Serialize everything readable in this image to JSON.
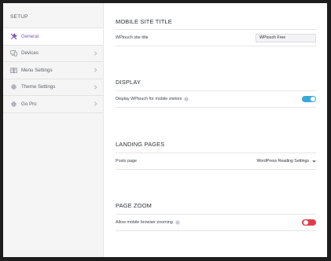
{
  "sidebar": {
    "header": "SETUP",
    "items": [
      {
        "label": "General",
        "icon": "wrench-icon",
        "active": true
      },
      {
        "label": "Devices",
        "icon": "devices-icon",
        "active": false
      },
      {
        "label": "Menu Settings",
        "icon": "menu-book-icon",
        "active": false
      },
      {
        "label": "Theme Settings",
        "icon": "gear-icon",
        "active": false
      },
      {
        "label": "Go Pro",
        "icon": "gear-icon",
        "active": false
      }
    ]
  },
  "sections": {
    "mobile_site_title": {
      "title": "MOBILE SITE TITLE",
      "field_label": "WPtouch site title",
      "field_value": "WPtouch Free"
    },
    "display": {
      "title": "DISPLAY",
      "field_label": "Display WPtouch for mobile visitors",
      "toggle_on": true
    },
    "landing_pages": {
      "title": "LANDING PAGES",
      "field_label": "Posts page",
      "selected": "WordPress Reading Settings"
    },
    "page_zoom": {
      "title": "PAGE ZOOM",
      "field_label": "Allow mobile browser zooming",
      "toggle_on": false
    }
  },
  "colors": {
    "accent_purple": "#7b55b3",
    "toggle_on": "#3aa8d9",
    "toggle_off": "#e33b4c"
  }
}
